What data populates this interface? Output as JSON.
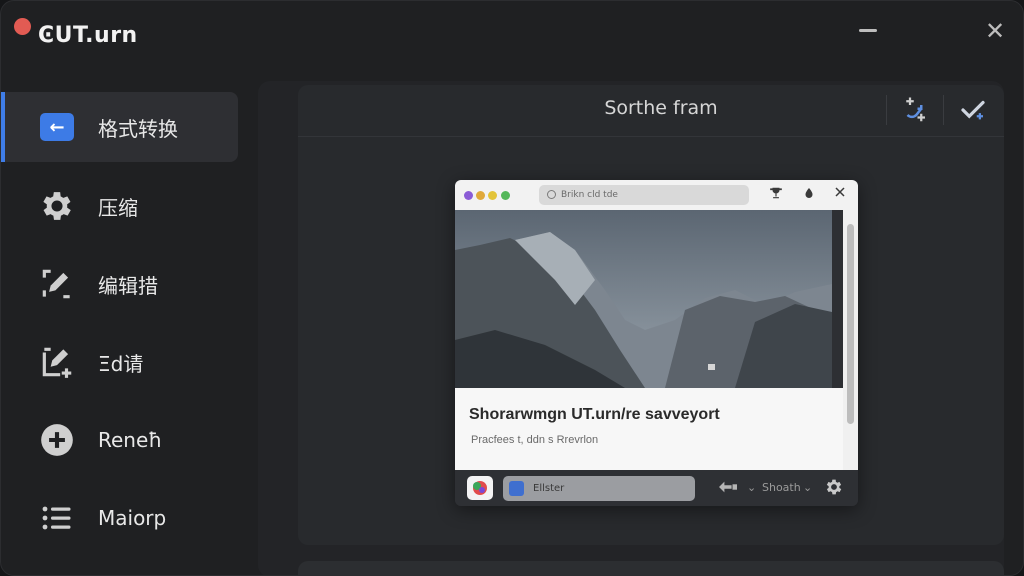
{
  "app": {
    "title": "ϾUT.urn"
  },
  "window_controls": {
    "close_glyph": "✕"
  },
  "sidebar": {
    "items": [
      {
        "label": "格式转换",
        "icon": "back-arrow-icon",
        "active": true
      },
      {
        "label": "压缩",
        "icon": "gear-icon",
        "active": false
      },
      {
        "label": "编辑措",
        "icon": "edit-pen-icon",
        "active": false
      },
      {
        "label": "Ξd请",
        "icon": "add-edit-icon",
        "active": false
      },
      {
        "label": "Reneħ",
        "icon": "plus-circle-icon",
        "active": false
      },
      {
        "label": "Maiorp",
        "icon": "list-icon",
        "active": false
      }
    ]
  },
  "main": {
    "header": {
      "title": "Sorthe fram"
    },
    "preview": {
      "url_text": "Brikn cld tde",
      "card_title": "Shorarwmgn UT.urn/re savveyort",
      "card_subtitle": "Pracfees t, ddn s Rrevrlon",
      "field_text": "Ellster",
      "control_text": "Shoath"
    }
  },
  "colors": {
    "accent": "#3f7de8",
    "close_dot": "#e25b53",
    "background": "#1f2022"
  }
}
